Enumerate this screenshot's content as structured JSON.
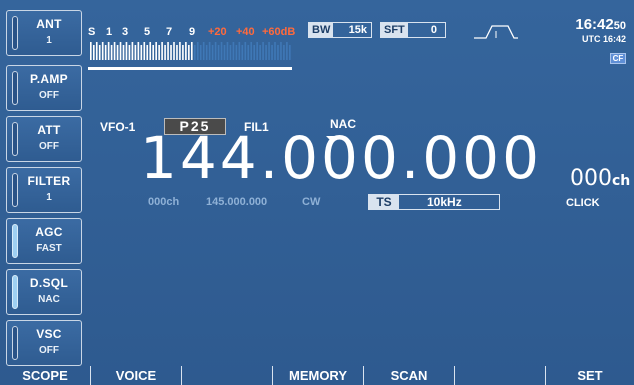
{
  "side_buttons": [
    {
      "label": "ANT",
      "value": "1",
      "active": false
    },
    {
      "label": "P.AMP",
      "value": "OFF",
      "active": false
    },
    {
      "label": "ATT",
      "value": "OFF",
      "active": false
    },
    {
      "label": "FILTER",
      "value": "1",
      "active": false
    },
    {
      "label": "AGC",
      "value": "FAST",
      "active": true
    },
    {
      "label": "D.SQL",
      "value": "NAC",
      "active": true
    },
    {
      "label": "VSC",
      "value": "OFF",
      "active": false
    }
  ],
  "smeter": {
    "scale": [
      "S",
      "1",
      "3",
      "5",
      "7",
      "9",
      "+20",
      "+40",
      "+60dB"
    ],
    "level_fraction": 0.52
  },
  "bw": {
    "label": "BW",
    "value": "15k"
  },
  "sft": {
    "label": "SFT",
    "value": "0"
  },
  "clock": {
    "time": "16:42",
    "seconds": "50",
    "utc": "UTC 16:42",
    "cf_badge": "CF"
  },
  "vfo": "VFO-1",
  "mode_badge": "P25",
  "filter": "FIL1",
  "nac": "NAC",
  "frequency": "144.000.000",
  "channel": {
    "number": "000",
    "unit": "ch"
  },
  "sub": {
    "channel": "000ch",
    "freq": "145.000.000",
    "mode": "CW"
  },
  "ts": {
    "label": "TS",
    "value": "10kHz"
  },
  "click": "CLICK",
  "bottom_keys": [
    "SCOPE",
    "VOICE",
    "",
    "MEMORY",
    "SCAN",
    "",
    "SET"
  ],
  "colors": {
    "background": "#2f5c91",
    "accent_red": "#ff6a3d",
    "meter_on": "#ffffff",
    "meter_off": "#3f78b6"
  }
}
